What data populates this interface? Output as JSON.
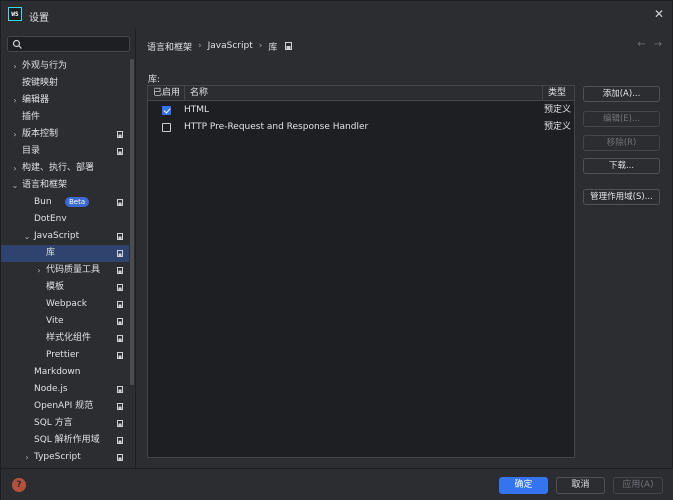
{
  "window": {
    "title": "设置",
    "app_icon_text": "WS"
  },
  "search": {
    "placeholder": ""
  },
  "sidebar": {
    "items": [
      {
        "label": "外观与行为",
        "arrow": "›",
        "badge": false
      },
      {
        "label": "按键映射",
        "arrow": "",
        "badge": false
      },
      {
        "label": "编辑器",
        "arrow": "›",
        "badge": false
      },
      {
        "label": "插件",
        "arrow": "",
        "badge": false
      },
      {
        "label": "版本控制",
        "arrow": "›",
        "badge": true
      },
      {
        "label": "目录",
        "arrow": "",
        "badge": true
      },
      {
        "label": "构建、执行、部署",
        "arrow": "›",
        "badge": false
      },
      {
        "label": "语言和框架",
        "arrow": "⌄",
        "badge": false
      },
      {
        "label": "Bun",
        "arrow": "",
        "badge": true,
        "tag": "Beta"
      },
      {
        "label": "DotEnv",
        "arrow": "",
        "badge": false
      },
      {
        "label": "JavaScript",
        "arrow": "⌄",
        "badge": true
      },
      {
        "label": "库",
        "arrow": "",
        "badge": true
      },
      {
        "label": "代码质量工具",
        "arrow": "›",
        "badge": true
      },
      {
        "label": "模板",
        "arrow": "",
        "badge": true
      },
      {
        "label": "Webpack",
        "arrow": "",
        "badge": true
      },
      {
        "label": "Vite",
        "arrow": "",
        "badge": true
      },
      {
        "label": "样式化组件",
        "arrow": "",
        "badge": true
      },
      {
        "label": "Prettier",
        "arrow": "",
        "badge": true
      },
      {
        "label": "Markdown",
        "arrow": "",
        "badge": false
      },
      {
        "label": "Node.js",
        "arrow": "",
        "badge": true
      },
      {
        "label": "OpenAPI 规范",
        "arrow": "",
        "badge": true
      },
      {
        "label": "SQL 方言",
        "arrow": "",
        "badge": true
      },
      {
        "label": "SQL 解析作用域",
        "arrow": "",
        "badge": true
      },
      {
        "label": "TypeScript",
        "arrow": "›",
        "badge": true
      }
    ]
  },
  "breadcrumb": {
    "part1": "语言和框架",
    "sep": "›",
    "part2": "JavaScript",
    "part3": "库"
  },
  "main": {
    "section_label": "库:",
    "columns": {
      "enabled": "已启用",
      "name": "名称",
      "type": "类型"
    },
    "rows": [
      {
        "enabled": true,
        "name": "HTML",
        "type": "预定义"
      },
      {
        "enabled": false,
        "name": "HTTP Pre-Request and Response Handler",
        "type": "预定义"
      }
    ],
    "buttons": {
      "add": "添加(A)...",
      "edit": "编辑(E)...",
      "remove": "移除(R)",
      "download": "下载...",
      "manage_scopes": "管理作用域(S)..."
    }
  },
  "footer": {
    "help": "?",
    "ok": "确定",
    "cancel": "取消",
    "apply": "应用(A)"
  },
  "colors": {
    "accent": "#3574f0",
    "selected_bg": "#2e436e",
    "background": "#2b2d30"
  }
}
